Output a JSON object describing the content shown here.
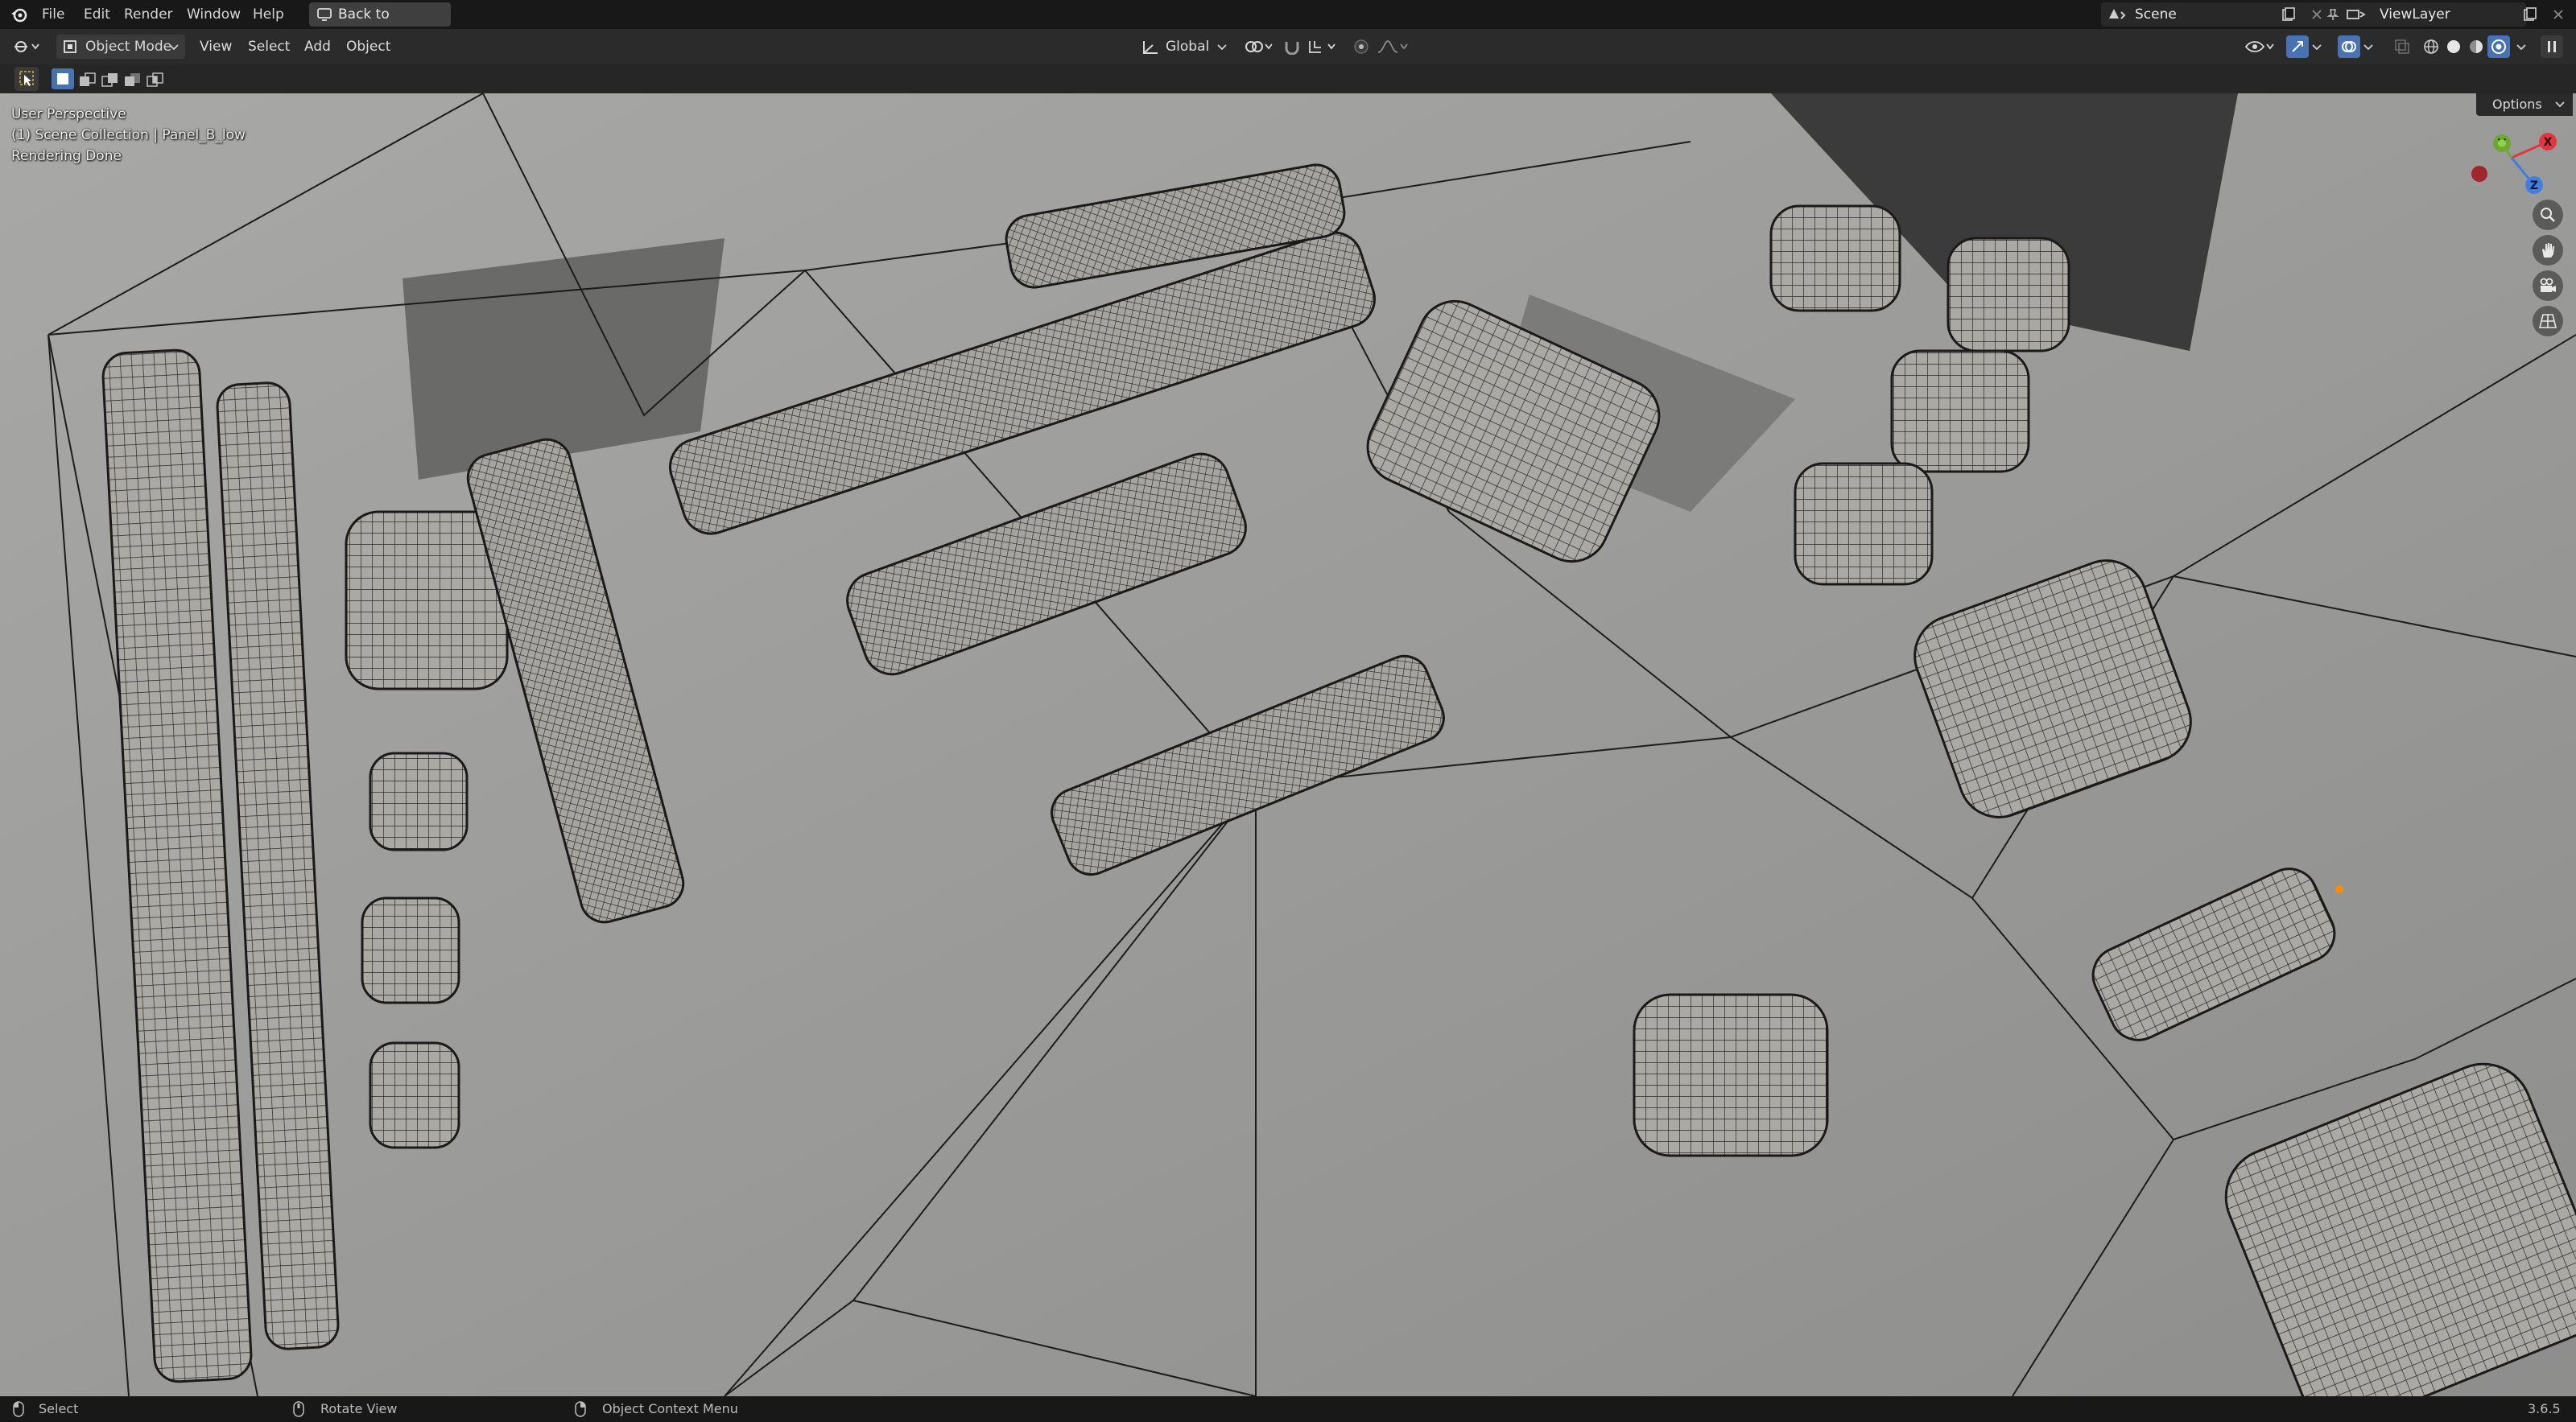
{
  "topbar": {
    "menus": [
      "File",
      "Edit",
      "Render",
      "Window",
      "Help"
    ],
    "back_button": "Back to Previous",
    "scene": "Scene",
    "view_layer": "ViewLayer"
  },
  "header": {
    "mode": "Object Mode",
    "menus": [
      "View",
      "Select",
      "Add",
      "Object"
    ],
    "orientation": "Global",
    "options": "Options"
  },
  "viewport": {
    "perspective": "User Perspective",
    "collection": "(1) Scene Collection | Panel_B_low",
    "status": "Rendering Done",
    "gizmo_axes": [
      "X",
      "Y",
      "Z"
    ]
  },
  "statusbar": {
    "select": "Select",
    "rotate": "Rotate View",
    "context": "Object Context Menu",
    "version": "3.6.5"
  },
  "colors": {
    "accent": "#4772b3",
    "axis_x": "#e0363f",
    "axis_y": "#6ea832",
    "axis_z": "#3f7fdf",
    "origin": "#ff8c00"
  }
}
